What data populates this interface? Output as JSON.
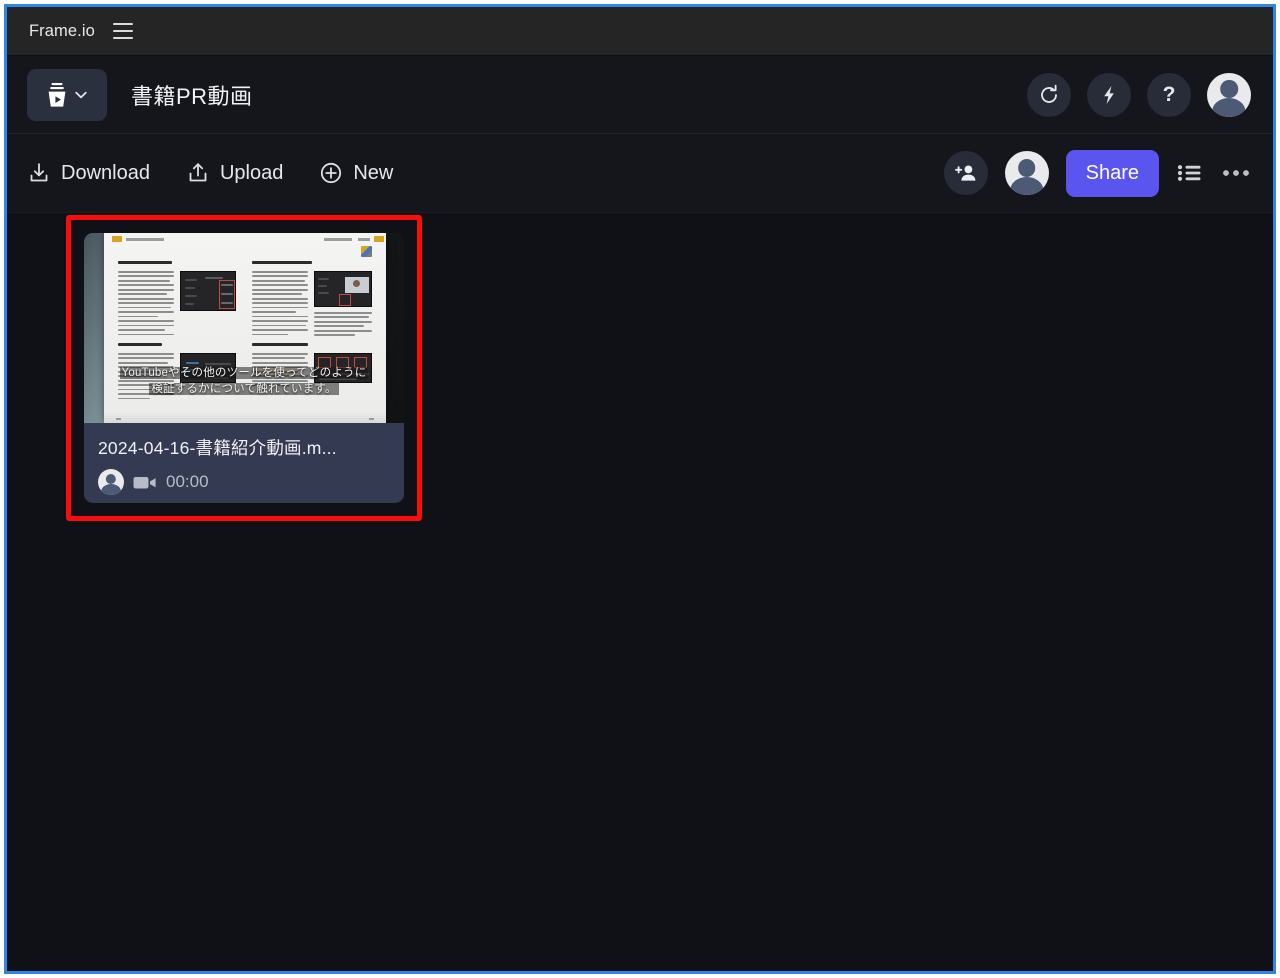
{
  "window": {
    "border_color": "#2e86e8"
  },
  "topbar": {
    "brand": "Frame.io",
    "menu_icon": "hamburger-icon"
  },
  "header": {
    "project_button": {
      "logo_icon": "frameio-cup-logo-icon",
      "chevron_icon": "chevron-down-icon"
    },
    "title": "書籍PR動画",
    "actions": [
      {
        "name": "refresh",
        "icon": "refresh-icon"
      },
      {
        "name": "lightning",
        "icon": "lightning-bolt-icon"
      },
      {
        "name": "help",
        "icon": "question-mark-icon",
        "glyph": "?"
      },
      {
        "name": "account",
        "icon": "avatar-icon"
      }
    ]
  },
  "toolbar": {
    "download_label": "Download",
    "download_icon": "download-icon",
    "upload_label": "Upload",
    "upload_icon": "upload-icon",
    "new_label": "New",
    "new_icon": "plus-circle-icon",
    "invite_icon": "add-person-icon",
    "collaborator_icon": "avatar-icon",
    "share_label": "Share",
    "share_color": "#5b55f0",
    "list_view_icon": "list-view-icon",
    "more_icon": "more-horizontal-icon"
  },
  "content": {
    "annotation": {
      "color": "#fb0d0d",
      "shape": "rectangle"
    },
    "asset": {
      "filename": "2024-04-16-書籍紹介動画.m...",
      "duration": "00:00",
      "media_icon": "video-camera-icon",
      "owner_icon": "avatar-icon",
      "thumbnail": {
        "subtitle_line1": "YouTubeやその他のツールを使ってどのように",
        "subtitle_line2": "検証するかについて触れています。"
      }
    }
  }
}
